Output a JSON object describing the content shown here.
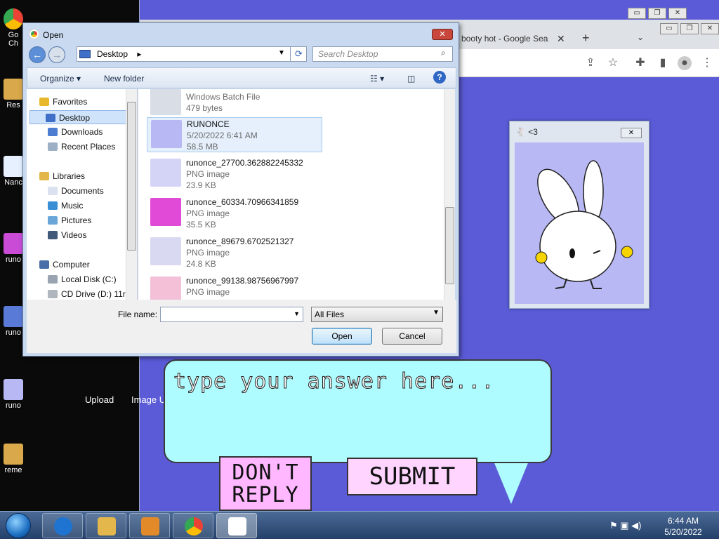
{
  "desktop": {
    "icons": [
      {
        "label": "Go\nCh",
        "color": "#e8eaed"
      },
      {
        "label": "Res",
        "color": "#d9a84a"
      },
      {
        "label": "Nanc",
        "color": "#e6f0ff"
      },
      {
        "label": "runo",
        "color": "#c94bd6"
      },
      {
        "label": "runo",
        "color": "#5a7ad8"
      },
      {
        "label": "runo",
        "color": "#b8b8f4"
      },
      {
        "label": "reme",
        "color": "#d9a84a"
      }
    ]
  },
  "chrome": {
    "tab_title": "booty hot - Google Sea",
    "tab_close": "✕",
    "new_tab": "+",
    "tab_dropdown": "⌄",
    "win_buttons": [
      "▭",
      "❐",
      "✕"
    ],
    "site_links": [
      "Upload",
      "Image U"
    ]
  },
  "bunny_window": {
    "title": "<3",
    "close": "✕"
  },
  "bubble": {
    "placeholder": "type your answer here...",
    "dont_reply_line1": "DON'T",
    "dont_reply_line2": "REPLY",
    "submit_label": "SUBMIT"
  },
  "dialog": {
    "title": "Open",
    "close": "✕",
    "back": "←",
    "forward": "→",
    "address": "Desktop",
    "address_arrow": "▸",
    "refresh": "⟳",
    "search_placeholder": "Search Desktop",
    "organize": "Organize ▾",
    "new_folder": "New folder",
    "help": "?",
    "nav": {
      "favorites": "Favorites",
      "desktop": "Desktop",
      "downloads": "Downloads",
      "recent_places": "Recent Places",
      "libraries": "Libraries",
      "documents": "Documents",
      "music": "Music",
      "pictures": "Pictures",
      "videos": "Videos",
      "computer": "Computer",
      "local_disk": "Local Disk (C:)",
      "cd_drive": "CD Drive (D:) 11r"
    },
    "files": [
      {
        "name": "",
        "type": "Windows Batch File",
        "size": "479 bytes",
        "thumb": "#d8dde6"
      },
      {
        "name": "RUNONCE",
        "type": "5/20/2022 6:41 AM",
        "size": "58.5 MB",
        "thumb": "#b8b8f4"
      },
      {
        "name": "runonce_27700.362882245332",
        "type": "PNG image",
        "size": "23.9 KB",
        "thumb": "#d4d4f6"
      },
      {
        "name": "runonce_60334.70966341859",
        "type": "PNG image",
        "size": "35.5 KB",
        "thumb": "#e04ad6"
      },
      {
        "name": "runonce_89679.6702521327",
        "type": "PNG image",
        "size": "24.8 KB",
        "thumb": "#d9d9f2"
      },
      {
        "name": "runonce_99138.98756967997",
        "type": "PNG image",
        "size": "",
        "thumb": "#f3c0d8"
      }
    ],
    "file_name_label": "File name:",
    "file_name_value": "",
    "filter": "All Files",
    "open_button": "Open",
    "cancel_button": "Cancel"
  },
  "taskbar": {
    "time": "6:44 AM",
    "date": "5/20/2022"
  }
}
